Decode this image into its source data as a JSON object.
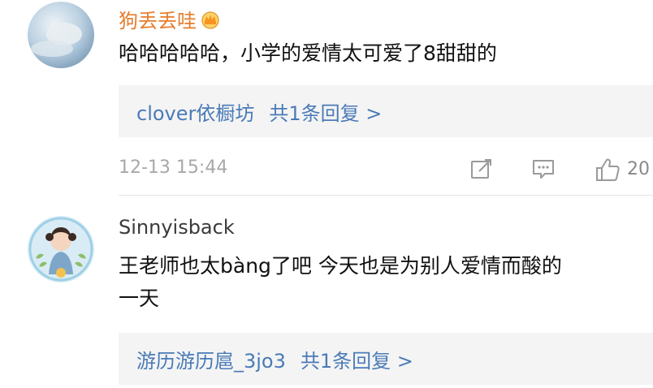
{
  "comments": [
    {
      "username": "狗丢丢哇",
      "username_color": "#e77c2c",
      "badge_icon": "crown-vip-icon",
      "text_lines": [
        "哈哈哈哈哈，小学的爱情太可爱了8甜甜的"
      ],
      "reply": {
        "name": "clover依橱坊",
        "count_label": "共1条回复 >"
      },
      "time": "12-13 15:44",
      "actions": {
        "share_icon": "share-icon",
        "comment_icon": "comment-icon",
        "like_icon": "thumbs-up-icon",
        "like_count": "20"
      }
    },
    {
      "username": "Sinnyisback",
      "username_color": "#3a3a3a",
      "text_lines": [
        "王老师也太bàng了吧 今天也是为别人爱情而酸的",
        "一天"
      ],
      "reply": {
        "name": "游历游历扈_3jo3",
        "count_label": "共1条回复 >"
      }
    }
  ],
  "colors": {
    "link_blue": "#4a7bb7",
    "reply_bg": "#f4f4f4",
    "meta_gray": "#a8a8a8"
  }
}
